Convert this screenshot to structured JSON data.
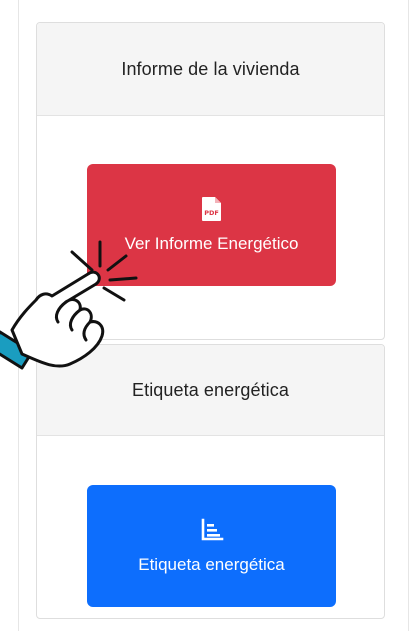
{
  "sections": [
    {
      "header": "Informe de la vivienda",
      "button_label": "Ver Informe Energético",
      "button_icon": "pdf-file-icon",
      "button_color": "#dc3545"
    },
    {
      "header": "Etiqueta energética",
      "button_label": "Etiqueta energética",
      "button_icon": "bar-chart-icon",
      "button_color": "#0d6efd"
    }
  ],
  "overlay": {
    "icon": "pointing-hand-click-icon",
    "accent_color": "#dc3545",
    "cuff_color": "#1a9dc0"
  }
}
